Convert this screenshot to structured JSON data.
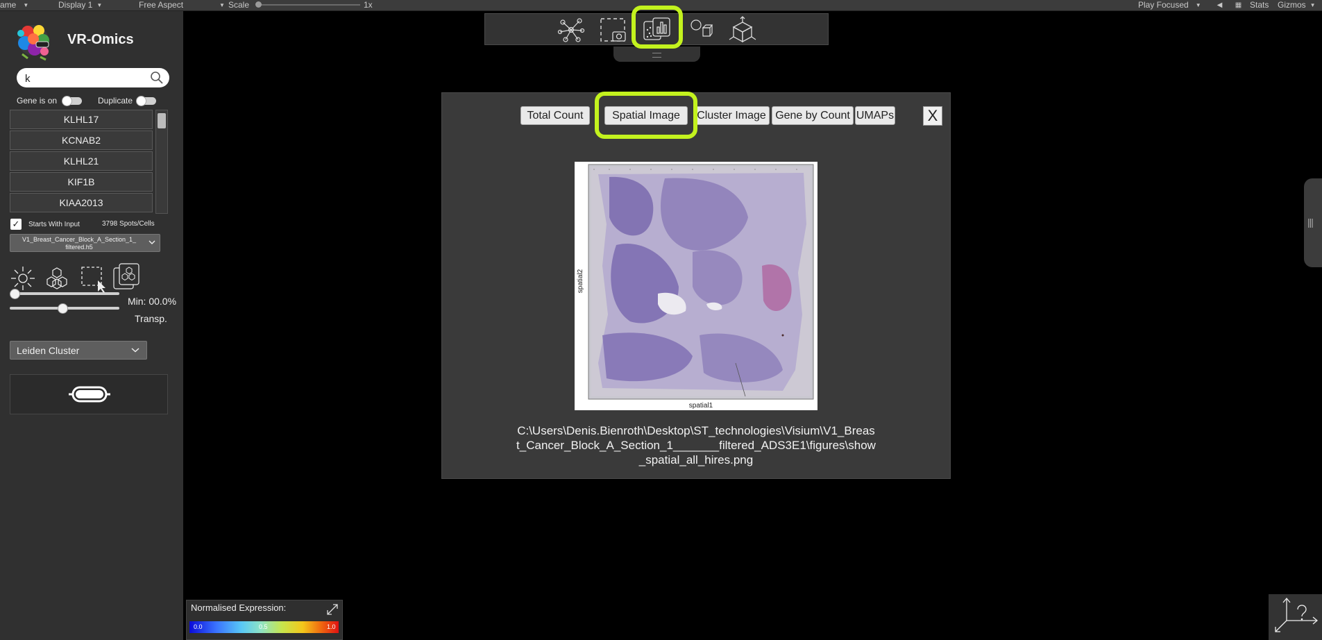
{
  "unity_toolbar": {
    "game_dropdown": "ame",
    "display_dropdown": "Display 1",
    "aspect_dropdown": "Free Aspect",
    "scale_label": "Scale",
    "scale_value": "1x",
    "play_focused": "Play Focused",
    "stats": "Stats",
    "gizmos": "Gizmos"
  },
  "sidebar": {
    "app_title": "VR-Omics",
    "search": {
      "value": "k",
      "placeholder": ""
    },
    "gene_is_on_label": "Gene is on",
    "duplicate_label": "Duplicate",
    "genes": [
      "KLHL17",
      "KCNAB2",
      "KLHL21",
      "KIF1B",
      "KIAA2013"
    ],
    "starts_with_input_label": "Starts With Input",
    "starts_with_input_checked": true,
    "spots_count": "3798 Spots/Cells",
    "dataset": "V1_Breast_Cancer_Block_A_Section_1_ filtered.h5",
    "min_label": "Min: 00.0%",
    "min_slider_fraction": 0.0,
    "transp_label": "Transp.",
    "transp_slider_fraction": 0.48,
    "cluster_select": "Leiden Cluster"
  },
  "top_toolbar": {
    "icons": [
      "network-icon",
      "screenshot-icon",
      "plots-icon",
      "shapes-icon",
      "cube-icon"
    ],
    "active": "plots-icon"
  },
  "plot_window": {
    "tabs": [
      "Total Count",
      "Spatial Image",
      "Cluster Image",
      "Gene by Count",
      "UMAPs"
    ],
    "active_tab": "Spatial Image",
    "close_label": "X",
    "plot": {
      "ylabel": "spatial2",
      "xlabel": "spatial1"
    },
    "file_path_lines": [
      "C:\\Users\\Denis.Bienroth\\Desktop\\ST_technologies\\Visium\\V1_Breas",
      "t_Cancer_Block_A_Section_1_______filtered_ADS3E1\\figures\\show",
      "_spatial_all_hires.png"
    ]
  },
  "legend": {
    "title": "Normalised Expression:",
    "ticks": [
      "0.0",
      "0.5",
      "1.0"
    ]
  },
  "colors": {
    "highlight": "#c3f21e",
    "panel_bg": "#303030",
    "window_bg": "#3a3a3a"
  }
}
